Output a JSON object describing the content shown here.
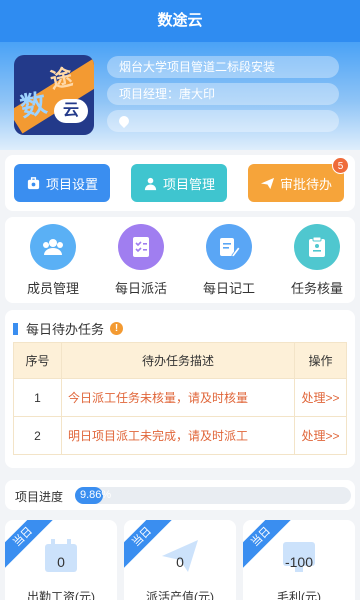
{
  "header": {
    "title": "数途云"
  },
  "project": {
    "logo_text_1": "数",
    "logo_text_2": "途",
    "logo_text_3": "云",
    "name": "烟台大学项目管道二标段安装",
    "manager": "项目经理：唐大印",
    "location": ""
  },
  "actions": {
    "settings": "项目设置",
    "manage": "项目管理",
    "approval": "审批待办",
    "approval_count": "5"
  },
  "shortcuts": [
    {
      "label": "成员管理",
      "icon": "people-icon"
    },
    {
      "label": "每日派活",
      "icon": "checklist-icon"
    },
    {
      "label": "每日记工",
      "icon": "edit-note-icon"
    },
    {
      "label": "任务核量",
      "icon": "clipboard-icon"
    }
  ],
  "tasks": {
    "title": "每日待办任务",
    "info": "!",
    "columns": {
      "no": "序号",
      "desc": "待办任务描述",
      "op": "操作"
    },
    "rows": [
      {
        "no": "1",
        "desc": "今日派工任务未核量，请及时核量",
        "op": "处理>>"
      },
      {
        "no": "2",
        "desc": "明日项目派工未完成，请及时派工",
        "op": "处理>>"
      }
    ]
  },
  "progress": {
    "label": "项目进度",
    "value_text": "9.86%",
    "percent": 9.86
  },
  "stats": [
    {
      "ribbon": "当日",
      "value": "0",
      "label": "出勤工资(元)",
      "icon": "calendar-icon"
    },
    {
      "ribbon": "当日",
      "value": "0",
      "label": "派活产值(元)",
      "icon": "send-icon"
    },
    {
      "ribbon": "当日",
      "value": "-100",
      "label": "毛利(元)",
      "icon": "chart-icon"
    }
  ],
  "colors": {
    "primary": "#3a8ef0",
    "teal": "#3fc5cf",
    "orange": "#f6a43a",
    "alert": "#e0663a"
  }
}
